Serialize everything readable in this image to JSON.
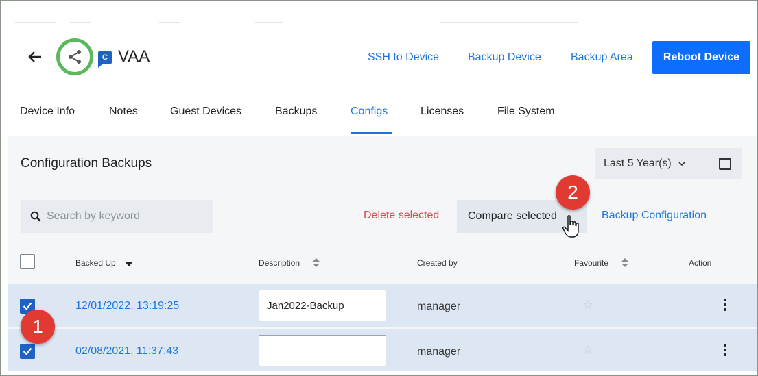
{
  "header": {
    "device_name": "VAA",
    "device_badge_letter": "C",
    "links": {
      "ssh": "SSH to Device",
      "backup_device": "Backup Device",
      "backup_area": "Backup Area"
    },
    "reboot_label": "Reboot Device",
    "icons": {
      "back": "arrow-left-icon",
      "share": "share-icon"
    }
  },
  "tabs": [
    {
      "label": "Device Info"
    },
    {
      "label": "Notes"
    },
    {
      "label": "Guest Devices"
    },
    {
      "label": "Backups"
    },
    {
      "label": "Configs",
      "active": true
    },
    {
      "label": "Licenses"
    },
    {
      "label": "File System"
    }
  ],
  "section": {
    "title": "Configuration Backups",
    "period": "Last 5 Year(s)"
  },
  "toolbar": {
    "search_placeholder": "Search by keyword",
    "delete_label": "Delete selected",
    "compare_label": "Compare selected",
    "backup_config_label": "Backup Configuration"
  },
  "table": {
    "columns": {
      "backed_up": "Backed Up",
      "description": "Description",
      "created_by": "Created by",
      "favourite": "Favourite",
      "action": "Action"
    },
    "rows": [
      {
        "checked": true,
        "date": "12/01/2022, 13:19:25",
        "description": "Jan2022-Backup",
        "created_by": "manager",
        "favourite": false
      },
      {
        "checked": true,
        "date": "02/08/2021, 11:37:43",
        "description": "",
        "created_by": "manager",
        "favourite": false
      }
    ]
  },
  "markers": {
    "one": "1",
    "two": "2"
  },
  "colors": {
    "accent": "#1f75e0",
    "primary_button": "#0d6efd",
    "danger": "#e0474c",
    "highlight_ring": "#5cb85c",
    "marker": "#e03a33",
    "row_selected": "#dde6f3"
  }
}
